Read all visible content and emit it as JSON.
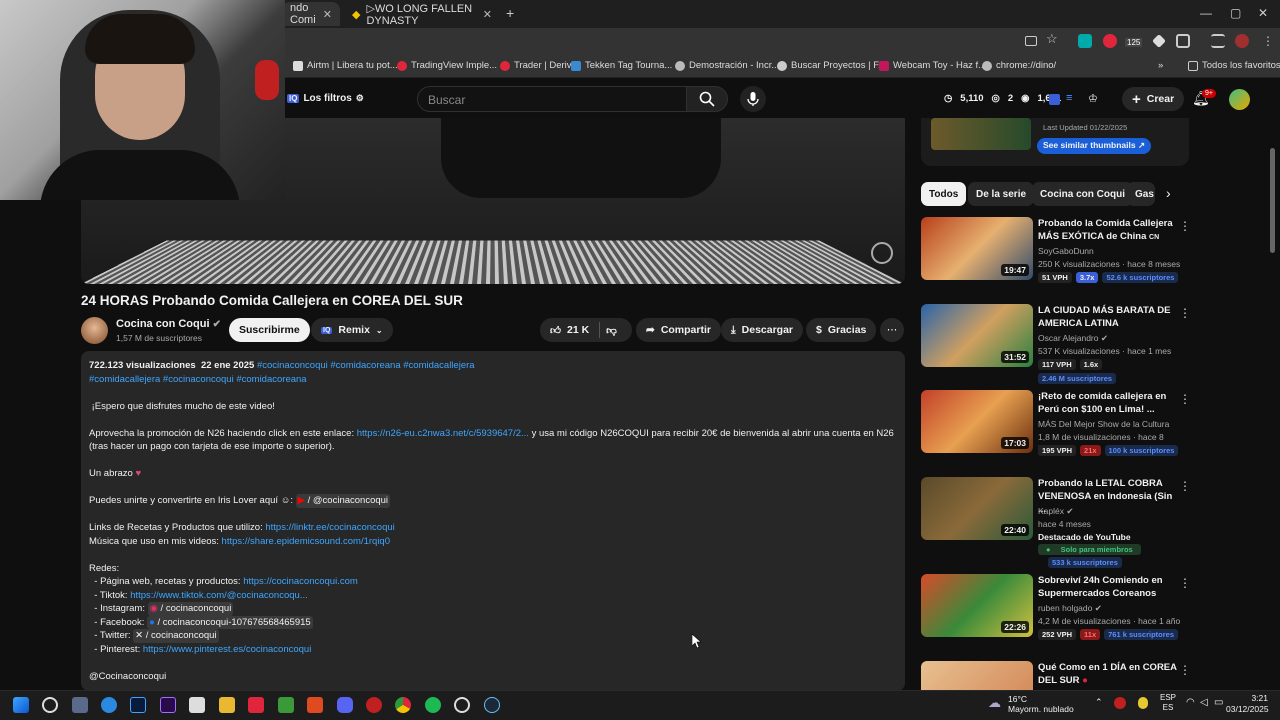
{
  "browser": {
    "tabs": [
      {
        "label": "ndo Comi"
      },
      {
        "label": "▷WO LONG FALLEN DYNASTY"
      }
    ],
    "bookmarks": [
      "Airtm | Libera tu pot...",
      "TradingView Imple...",
      "Trader | Deriv",
      "Tekken Tag Tourna...",
      "Demostración - Incr...",
      "Buscar Proyectos | F...",
      "Webcam Toy - Haz f...",
      "chrome://dino/"
    ],
    "bookmarks_all": "Todos los favoritos",
    "ext_badge": "125"
  },
  "header": {
    "filters": "Los filtros",
    "search_placeholder": "Buscar",
    "stat1": "5,110",
    "stat2": "2",
    "stat3": "1,671",
    "create": "Crear",
    "notif": "9+"
  },
  "video": {
    "title": "24 HORAS Probando Comida Callejera en COREA DEL SUR",
    "channel": "Cocina con Coqui",
    "subs": "1,57 M de suscriptores",
    "subscribe": "Suscribirme",
    "remix": "Remix",
    "likes": "21 K",
    "share": "Compartir",
    "download": "Descargar",
    "thanks": "Gracias"
  },
  "description": {
    "views": "722.123 visualizaciones",
    "date": "22 ene 2025",
    "tags1": "#cocinaconcoqui #comidacoreana #comidacallejera",
    "tags2": "#comidacallejera #cocinaconcoqui #comidacoreana",
    "l1": "¡Espero que disfrutes mucho de este video!",
    "l2a": "Aprovecha la promoción de N26 haciendo click en este enlace:",
    "l2link": "https://n26-eu.c2nwa3.net/c/5939647/2...",
    "l2b": "y usa mi código N26COQUI para recibir 20€ de bienvenida al abrir una cuenta en N26",
    "l2c": "(tras hacer un pago con tarjeta de ese importe o superior).",
    "l3": "Un abrazo",
    "l4": "Puedes unirte y convertirte en Iris Lover aquí",
    "l4chip": "/ @cocinaconcoqui",
    "l5a": "Links de Recetas y Productos que utilizo:",
    "l5link": "https://linktr.ee/cocinaconcoqui",
    "l6a": "Música que uso en mis videos:",
    "l6link": "https://share.epidemicsound.com/1rqiq0",
    "redes": "Redes:",
    "r1a": "- Página web, recetas y productos:",
    "r1link": "https://cocinaconcoqui.com",
    "r2a": "- Tiktok:",
    "r2link": "https://www.tiktok.com/@cocinaconcoqu...",
    "r3a": "- Instagram:",
    "r3chip": "/ cocinaconcoqui",
    "r4a": "- Facebook:",
    "r4chip": "/ cocinaconcoqui-107676568465915",
    "r5a": "- Twitter:",
    "r5chip": "/ cocinaconcoqui",
    "r6a": "- Pinterest:",
    "r6link": "https://www.pinterest.es/cocinaconcoqui",
    "sign": "@Cocinaconcoqui"
  },
  "sidebar": {
    "last_updated": "Last Updated 01/22/2025",
    "similar": "See similar thumbnails",
    "chips": [
      "Todos",
      "De la serie",
      "Cocina con Coqui",
      "Gas"
    ],
    "recs": [
      {
        "title": "Probando la Comida Callejera MÁS EXÓTICA de China",
        "title_suffix": "CN",
        "channel": "SoyGaboDunn",
        "meta": "250 K visualizaciones · hace 8 meses",
        "dur": "19:47",
        "b1": "51 VPH",
        "b2": "3.7x",
        "b3": "52.6 k suscriptores"
      },
      {
        "title": "LA CIUDAD MÁS BARATA DE AMERICA LATINA",
        "channel": "Oscar Alejandro",
        "meta": "537 K visualizaciones · hace 1 mes",
        "dur": "31:52",
        "b1": "117 VPH",
        "b2": "1.6x",
        "b3": "2.46 M suscriptores"
      },
      {
        "title": "¡Reto de comida callejera en Perú con $100 en Lima! ...",
        "channel": "MÁS Del Mejor Show de la Cultura",
        "meta": "1,8 M de visualizaciones · hace 8 meses",
        "dur": "17:03",
        "b1": "195 VPH",
        "b2": "21x",
        "b3": "100 k suscriptores"
      },
      {
        "title": "Probando la LETAL COBRA VENENOSA en Indonesia (Sin ...",
        "channel": "Kapléx",
        "meta": "hace 4 meses",
        "extra": "Destacado de YouTube",
        "members": "Solo para miembros",
        "dur": "22:40",
        "b3": "533 k suscriptores"
      },
      {
        "title": "Sobreviví 24h Comiendo en Supermercados Coreanos",
        "channel": "ruben holgado",
        "meta": "4,2 M de visualizaciones · hace 1 año",
        "dur": "22:26",
        "b1": "252 VPH",
        "b2": "11x",
        "b3": "761 k suscriptores"
      },
      {
        "title": "Qué Como en 1 DÍA en COREA DEL SUR",
        "channel": "",
        "meta": "",
        "dur": ""
      }
    ]
  },
  "taskbar": {
    "weather_temp": "16°C",
    "weather_desc": "Mayorm. nublado",
    "lang1": "ESP",
    "lang2": "ES",
    "time": "3:21",
    "date": "03/12/2025"
  }
}
